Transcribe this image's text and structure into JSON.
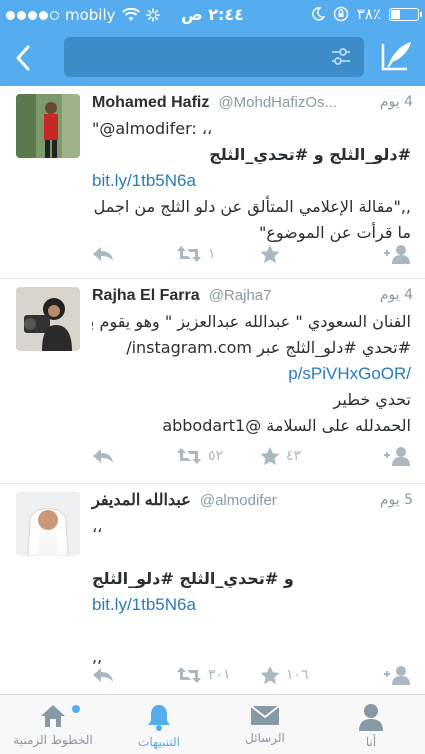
{
  "status_bar": {
    "carrier": "mobily",
    "time": "٢:٤٤ ص",
    "battery": "٣٨٪"
  },
  "colors": {
    "brand": "#55acee",
    "link": "#2b7bb9",
    "muted": "#8899a6"
  },
  "tweets": [
    {
      "name": "Mohamed Hafiz",
      "handle": "@MohdHafizOs...",
      "time": "4 يوم",
      "lines": [
        {
          "text": "\"@almodifer: ،،",
          "kind": "ltr"
        },
        {
          "text": "#دلو_الثلج و #تحدي_الثلج",
          "kind": "rtl"
        },
        {
          "text": "bit.ly/1tb5N6a",
          "kind": "link"
        },
        {
          "text": ",,\"مقالة الإعلامي المتألق عن دلو الثلج من اجمل",
          "kind": "rtl"
        },
        {
          "text": "ما قرأت عن الموضوع\"",
          "kind": "rtl"
        }
      ],
      "retweets": "١",
      "favorites": ""
    },
    {
      "name": "Rajha El Farra",
      "handle": "@Rajha7",
      "time": "4 يوم",
      "lines": [
        {
          "text": "الفنان السعودي \" عبدالله عبدالعزيز \" وهو يقوم بـ",
          "kind": "rtl"
        },
        {
          "text": "#تحدي #دلو_الثلج عبر  instagram.com/",
          "kind": "rtl"
        },
        {
          "text": "p/sPiVHxGoOR/",
          "kind": "link-right"
        },
        {
          "text": "تحدي خطير",
          "kind": "rtl"
        },
        {
          "text": "الحمدلله على السلامة @abbodart1",
          "kind": "rtl"
        }
      ],
      "retweets": "٥٢",
      "favorites": "٤٣"
    },
    {
      "name": "عبدالله المديفر",
      "handle": "@almodifer",
      "time": "5 يوم",
      "lines": [
        {
          "text": "،،",
          "kind": "ltr"
        },
        {
          "text": "",
          "kind": "ltr"
        },
        {
          "text": "و #تحدي_الثلج #دلو_الثلج",
          "kind": "ltr"
        },
        {
          "text": "bit.ly/1tb5N6a",
          "kind": "link"
        },
        {
          "text": "",
          "kind": "ltr"
        },
        {
          "text": ",,",
          "kind": "ltr"
        }
      ],
      "retweets": "٣٠١",
      "favorites": "١٠٦"
    }
  ],
  "tabs": [
    {
      "label": "الخطوط الزمنية",
      "icon": "home-icon"
    },
    {
      "label": "التنبيهات",
      "icon": "bell-icon"
    },
    {
      "label": "الرسائل",
      "icon": "envelope-icon"
    },
    {
      "label": "أنا",
      "icon": "person-icon"
    }
  ]
}
